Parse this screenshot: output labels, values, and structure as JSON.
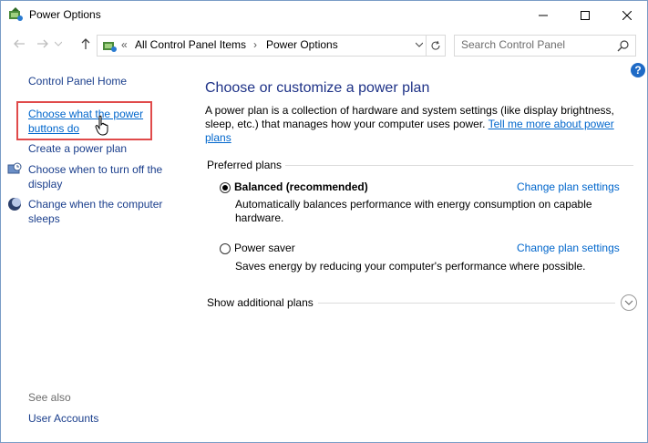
{
  "window": {
    "title": "Power Options"
  },
  "address": {
    "prefix": "«",
    "crumbs": [
      "All Control Panel Items",
      "Power Options"
    ],
    "separator": "›"
  },
  "search": {
    "placeholder": "Search Control Panel"
  },
  "help": {
    "label": "?"
  },
  "sidebar": {
    "home": "Control Panel Home",
    "items": [
      {
        "label1": "Choose what the power",
        "label2": "buttons do"
      },
      {
        "label1": "Create a power plan"
      },
      {
        "label1": "Choose when to turn off the",
        "label2": "display"
      },
      {
        "label1": "Change when the computer",
        "label2": "sleeps"
      }
    ],
    "see_also": "See also",
    "user_accounts": "User Accounts"
  },
  "main": {
    "heading": "Choose or customize a power plan",
    "desc_line1": "A power plan is a collection of hardware and system settings (like display brightness,",
    "desc_line2": "sleep, etc.) that manages how your computer uses power.",
    "desc_link1": "Tell me more about power",
    "desc_link2": "plans",
    "preferred_label": "Preferred plans",
    "plans": [
      {
        "name": "Balanced (recommended)",
        "selected": true,
        "desc1": "Automatically balances performance with energy consumption on capable",
        "desc2": "hardware.",
        "link": "Change plan settings"
      },
      {
        "name": "Power saver",
        "selected": false,
        "desc1": "Saves energy by reducing your computer's performance where possible.",
        "link": "Change plan settings"
      }
    ],
    "show_more": "Show additional plans"
  },
  "colors": {
    "accent": "#1e3287",
    "link": "#0066cc",
    "highlight": "#e04a4a"
  }
}
